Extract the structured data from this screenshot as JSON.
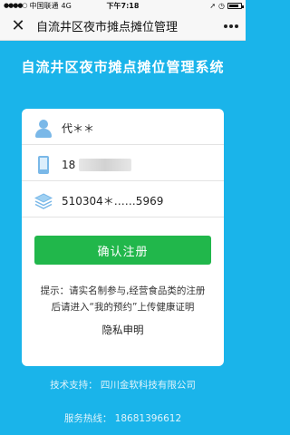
{
  "status_bar": {
    "carrier": "中国联通",
    "network": "4G",
    "time": "下午7:18",
    "battery_level": 0.8
  },
  "nav": {
    "close_icon": "close-icon",
    "title": "自流井区夜市摊点摊位管理",
    "more_icon": "more-dots-icon"
  },
  "page": {
    "title": "自流井区夜市摊点摊位管理系统"
  },
  "form": {
    "name_value": "代＊＊",
    "phone_value": "18",
    "id_value": "510304＊……5969",
    "confirm_label": "确认注册",
    "notice_line1": "提示：请实名制参与,经营食品类的注册",
    "notice_line2": "后请进入“我的预约”上传健康证明",
    "privacy_label": "隐私申明"
  },
  "footer": {
    "support": "技术支持：  四川金软科技有限公司",
    "hotline": "服务热线：  18681396612"
  },
  "colors": {
    "background": "#1ab4ea",
    "button": "#21b74b",
    "icon": "#7ab8e8"
  }
}
